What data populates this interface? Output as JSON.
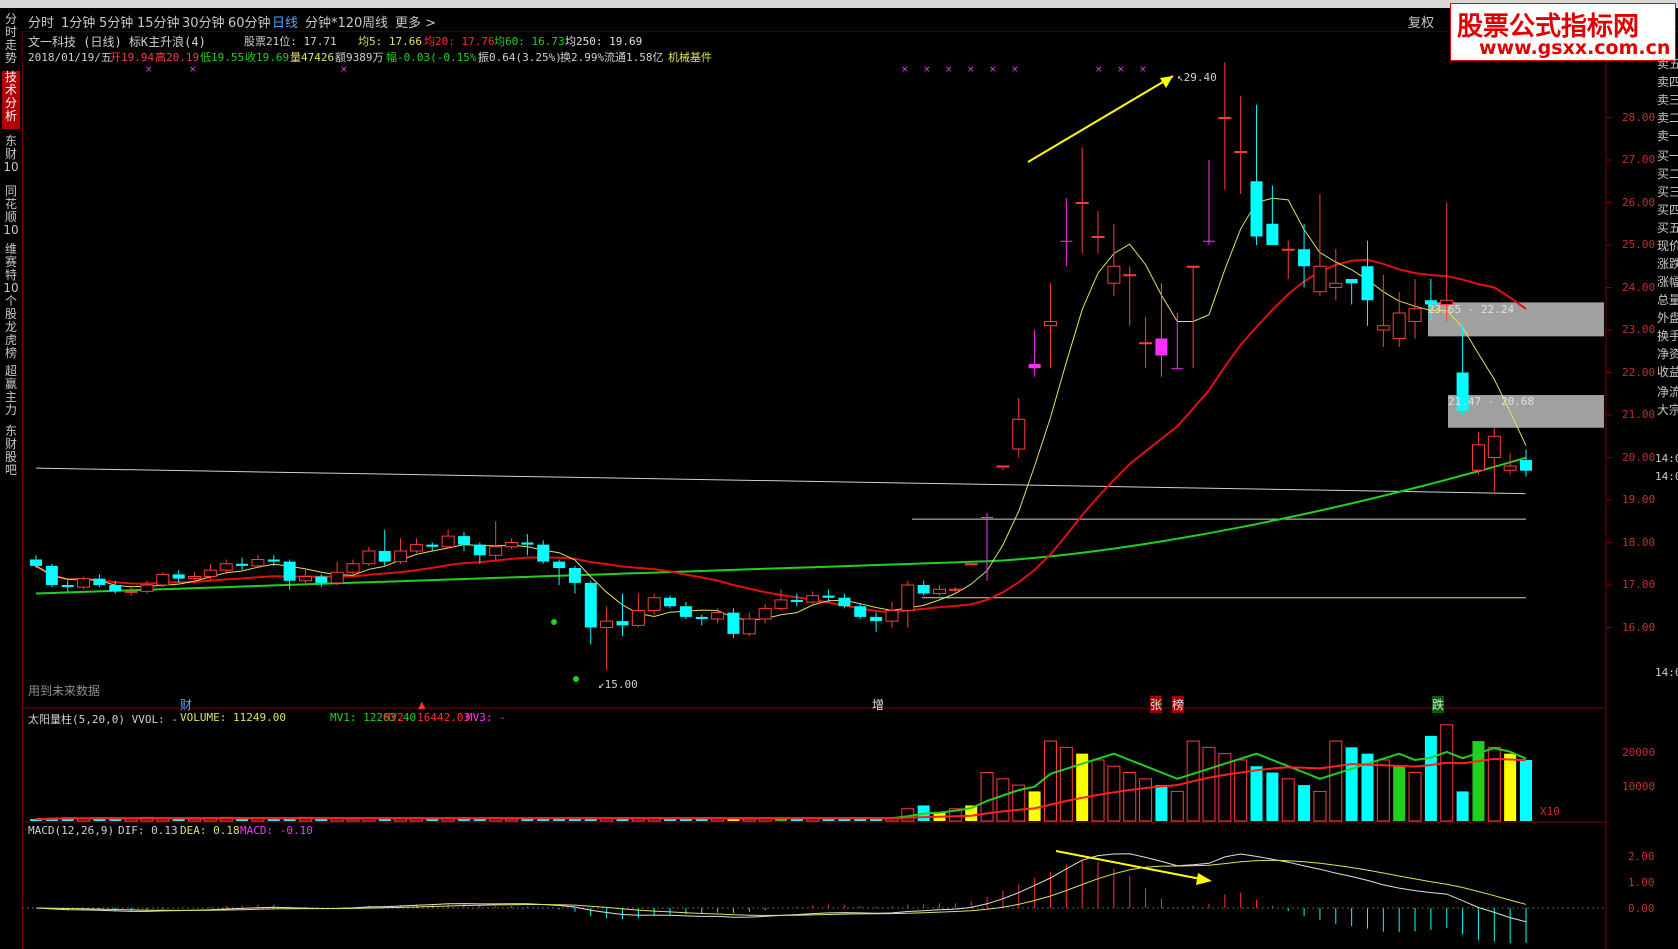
{
  "period_bar": {
    "tabs": [
      "分时",
      "1分钟",
      "5分钟",
      "15分钟",
      "30分钟",
      "60分钟",
      "日线",
      "分钟*120",
      "周线",
      "更多 >"
    ],
    "active": "日线",
    "restore_right": "复权"
  },
  "side_tabs": [
    "分时走势",
    "技术分析",
    "东财10",
    "同花顺10",
    "维赛特10",
    "个股龙虎榜",
    "超赢主力",
    "东财股吧"
  ],
  "side_active": "技术分析",
  "watermark": {
    "line1": "股票公式指标网",
    "line2": "www.gsxx.com.cn"
  },
  "header": {
    "stock": "文一科技 (日线) 标K主升浪(4)",
    "rank": "股票21位: 17.71",
    "ma5": "均5: 17.66",
    "ma20": "均20: 17.76",
    "ma60": "均60: 16.73",
    "ma250": "均250: 19.69"
  },
  "ohlc": {
    "date": "2018/01/19/五",
    "open": "开19.94",
    "high": "高20.19",
    "low": "低19.55",
    "close": "收19.69",
    "volume": "量47426",
    "amount": "额9389万",
    "change": "幅-0.03(-0.15%)",
    "amplitude": "振0.64(3.25%)",
    "turnover": "换2.99%",
    "float": "流通1.58亿",
    "sector": "机械基件"
  },
  "right_panel": [
    "卖五",
    "卖四",
    "卖三",
    "卖二",
    "卖一",
    "买一",
    "买二",
    "买三",
    "买四",
    "买五",
    "现价",
    "涨跌",
    "涨幅",
    "总量",
    "外盘",
    "换手",
    "净资",
    "收益",
    "净流",
    "大宗"
  ],
  "price_axis": [
    "28.00",
    "27.00",
    "26.00",
    "25.00",
    "24.00",
    "23.00",
    "22.00",
    "21.00",
    "20.00",
    "19.00",
    "18.00",
    "17.00",
    "16.00"
  ],
  "axis_time_labels": [
    "14:0",
    "14:0",
    "14:0"
  ],
  "annotations": {
    "peak": "29.40",
    "low": "15.00",
    "zone1": "23.65 - 22.24",
    "zone2": "21.47 - 20.68",
    "future_data": "用到未来数据",
    "events": [
      "财",
      "增",
      "张",
      "榜",
      "跌"
    ]
  },
  "volume_header": {
    "name": "太阳量柱(5,20,0) VVOL: -",
    "volume": "VOLUME: 11249.00",
    "mv1": "MV1: 12263.40",
    "mv2": "MV2: 16442.03",
    "mv3": "MV3: -"
  },
  "volume_axis": [
    "20000",
    "10000"
  ],
  "volume_unit": "X10",
  "macd_header": {
    "name": "MACD(12,26,9)",
    "dif": "DIF: 0.13",
    "dea": "DEA: 0.18",
    "macd": "MACD: -0.10"
  },
  "macd_axis": [
    "2.00",
    "1.00",
    "0.00"
  ],
  "colors": {
    "up": "#ff3c3c",
    "down": "#00ffff",
    "ma5": "#e0e060",
    "ma20": "#e01010",
    "ma60": "#20d020",
    "magenta": "#ff30ff"
  },
  "chart_data": {
    "type": "candlestick",
    "y_range": [
      15,
      29.4
    ],
    "candles": [
      [
        17.6,
        17.45,
        17.7,
        17.4
      ],
      [
        17.45,
        17.0,
        17.5,
        16.95
      ],
      [
        17.0,
        16.95,
        17.1,
        16.85
      ],
      [
        16.95,
        17.15,
        17.2,
        16.9
      ],
      [
        17.15,
        17.0,
        17.25,
        16.95
      ],
      [
        17.0,
        16.85,
        17.1,
        16.8
      ],
      [
        16.85,
        16.85,
        16.95,
        16.75
      ],
      [
        16.85,
        17.0,
        17.1,
        16.8
      ],
      [
        17.0,
        17.25,
        17.3,
        16.95
      ],
      [
        17.25,
        17.15,
        17.35,
        17.05
      ],
      [
        17.15,
        17.2,
        17.3,
        17.05
      ],
      [
        17.2,
        17.35,
        17.5,
        17.1
      ],
      [
        17.35,
        17.5,
        17.6,
        17.25
      ],
      [
        17.5,
        17.45,
        17.65,
        17.35
      ],
      [
        17.45,
        17.6,
        17.7,
        17.4
      ],
      [
        17.6,
        17.55,
        17.7,
        17.45
      ],
      [
        17.55,
        17.1,
        17.6,
        16.9
      ],
      [
        17.1,
        17.2,
        17.4,
        17.0
      ],
      [
        17.2,
        17.05,
        17.25,
        16.95
      ],
      [
        17.05,
        17.3,
        17.55,
        17.0
      ],
      [
        17.3,
        17.5,
        17.6,
        17.25
      ],
      [
        17.5,
        17.8,
        17.9,
        17.45
      ],
      [
        17.8,
        17.55,
        18.3,
        17.45
      ],
      [
        17.55,
        17.8,
        18.1,
        17.5
      ],
      [
        17.8,
        17.95,
        18.1,
        17.75
      ],
      [
        17.95,
        17.9,
        18.0,
        17.8
      ],
      [
        17.9,
        18.15,
        18.3,
        17.85
      ],
      [
        18.15,
        17.95,
        18.25,
        17.8
      ],
      [
        17.95,
        17.7,
        18.0,
        17.5
      ],
      [
        17.7,
        17.9,
        18.5,
        17.6
      ],
      [
        17.9,
        18.0,
        18.1,
        17.85
      ],
      [
        18.0,
        17.95,
        18.2,
        17.7
      ],
      [
        17.95,
        17.55,
        18.05,
        17.5
      ],
      [
        17.55,
        17.4,
        17.6,
        17.0
      ],
      [
        17.4,
        17.05,
        17.45,
        16.8
      ],
      [
        17.05,
        16.0,
        17.1,
        15.6
      ],
      [
        16.0,
        16.15,
        16.5,
        15.0
      ],
      [
        16.15,
        16.05,
        16.8,
        15.8
      ],
      [
        16.05,
        16.4,
        16.8,
        16.0
      ],
      [
        16.4,
        16.7,
        16.8,
        16.3
      ],
      [
        16.7,
        16.5,
        16.75,
        16.45
      ],
      [
        16.5,
        16.25,
        16.6,
        16.2
      ],
      [
        16.25,
        16.2,
        16.3,
        16.05
      ],
      [
        16.2,
        16.35,
        16.45,
        16.1
      ],
      [
        16.35,
        15.85,
        16.45,
        15.75
      ],
      [
        15.85,
        16.2,
        16.35,
        15.8
      ],
      [
        16.2,
        16.45,
        16.55,
        16.1
      ],
      [
        16.45,
        16.65,
        16.9,
        16.4
      ],
      [
        16.65,
        16.6,
        16.8,
        16.5
      ],
      [
        16.6,
        16.75,
        16.85,
        16.55
      ],
      [
        16.75,
        16.7,
        16.9,
        16.6
      ],
      [
        16.7,
        16.5,
        16.8,
        16.45
      ],
      [
        16.5,
        16.25,
        16.55,
        16.2
      ],
      [
        16.25,
        16.15,
        16.35,
        15.9
      ],
      [
        16.15,
        16.4,
        16.6,
        16.0
      ],
      [
        16.4,
        17.0,
        17.1,
        16.0
      ],
      [
        17.0,
        16.8,
        17.1,
        16.75
      ],
      [
        16.8,
        16.9,
        17.0,
        16.75
      ],
      [
        16.9,
        16.9,
        16.95,
        16.8
      ],
      [
        17.5,
        17.5,
        17.5,
        17.5
      ],
      [
        18.6,
        18.6,
        18.7,
        17.1
      ],
      [
        19.8,
        19.8,
        19.8,
        19.7
      ],
      [
        20.2,
        20.9,
        21.4,
        20.0
      ],
      [
        22.1,
        22.2,
        23.0,
        21.9
      ],
      [
        23.1,
        23.2,
        24.1,
        22.1
      ],
      [
        25.1,
        25.1,
        26.1,
        24.5
      ],
      [
        26.0,
        26.0,
        27.3,
        24.8
      ],
      [
        25.2,
        25.2,
        25.8,
        24.8
      ],
      [
        24.1,
        24.5,
        25.5,
        23.8
      ],
      [
        24.3,
        24.3,
        24.5,
        23.1
      ],
      [
        22.7,
        22.7,
        23.3,
        22.1
      ],
      [
        22.8,
        22.4,
        24.1,
        21.9
      ],
      [
        22.1,
        22.1,
        23.4,
        22.1
      ],
      [
        24.5,
        24.5,
        24.5,
        22.1
      ],
      [
        25.1,
        25.1,
        27.0,
        25.0
      ],
      [
        28.0,
        28.0,
        29.3,
        26.3
      ],
      [
        27.2,
        27.2,
        28.5,
        26.2
      ],
      [
        26.5,
        25.2,
        28.3,
        25.0
      ],
      [
        25.5,
        25.0,
        26.4,
        25.0
      ],
      [
        24.9,
        24.9,
        25.1,
        24.2
      ],
      [
        24.9,
        24.5,
        25.5,
        24.0
      ],
      [
        23.9,
        24.5,
        26.2,
        23.8
      ],
      [
        24.0,
        24.1,
        24.9,
        23.7
      ],
      [
        24.2,
        24.1,
        24.2,
        23.6
      ],
      [
        24.5,
        23.7,
        25.1,
        23.1
      ],
      [
        23.0,
        23.1,
        24.3,
        22.6
      ],
      [
        22.8,
        23.4,
        23.9,
        22.6
      ],
      [
        23.2,
        23.5,
        24.2,
        22.8
      ],
      [
        23.7,
        23.6,
        24.2,
        23.2
      ],
      [
        23.6,
        23.7,
        26.0,
        23.2
      ],
      [
        22.0,
        21.1,
        23.1,
        21.0
      ],
      [
        19.7,
        20.3,
        20.6,
        19.6
      ],
      [
        20.0,
        20.5,
        20.7,
        19.2
      ],
      [
        19.7,
        19.8,
        20.1,
        19.6
      ],
      [
        19.94,
        19.69,
        20.19,
        19.55
      ]
    ]
  }
}
